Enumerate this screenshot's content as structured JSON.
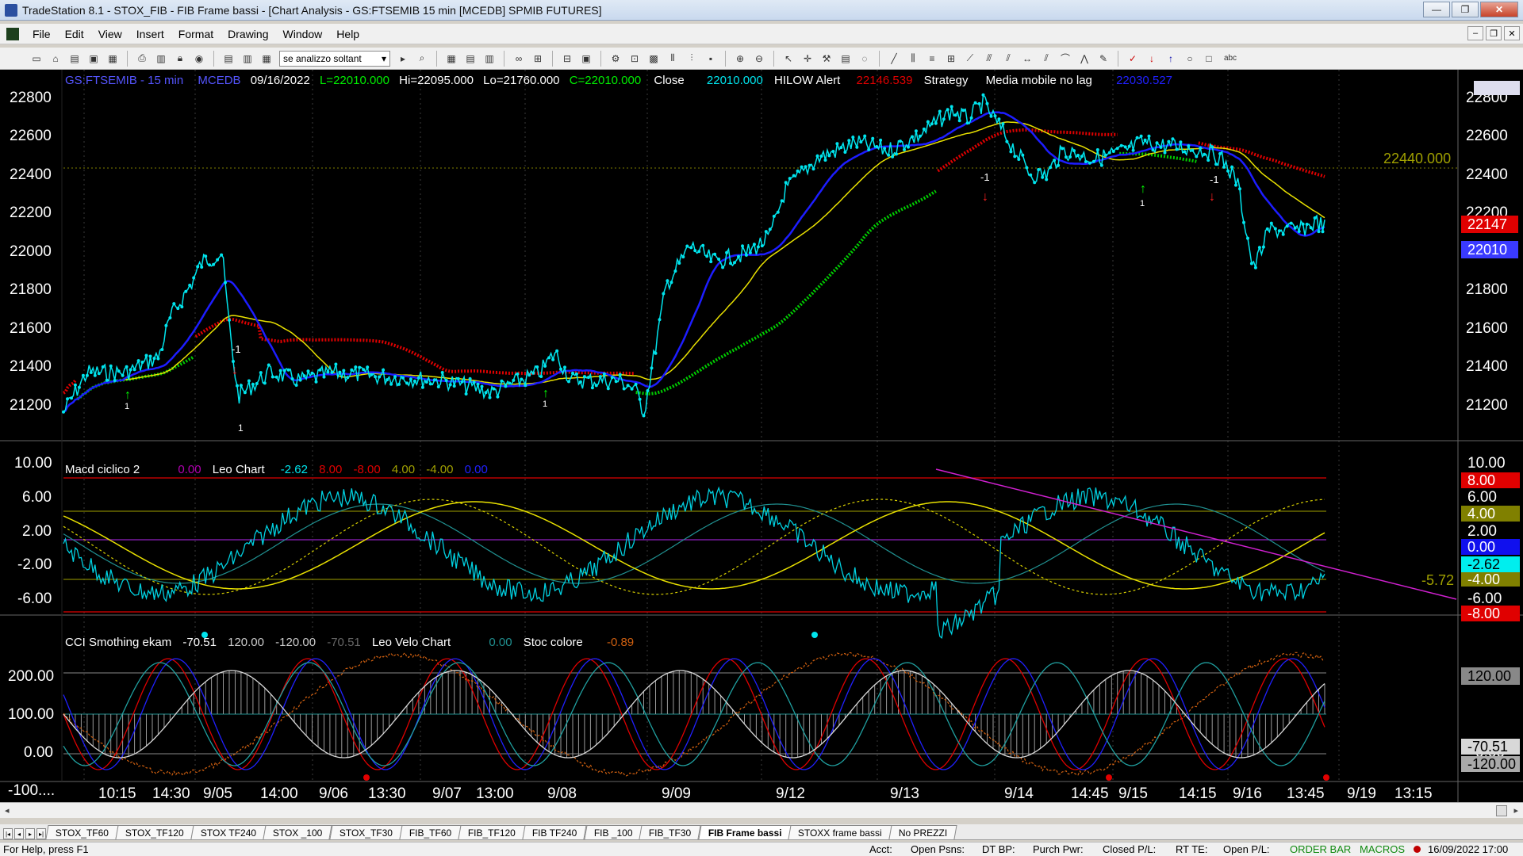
{
  "window": {
    "title": "TradeStation 8.1 - STOX_FIB - FIB Frame bassi - [Chart Analysis - GS:FTSEMIB  15 min  [MCEDB] SPMIB FUTURES]",
    "controls": [
      "—",
      "❐",
      "✕"
    ]
  },
  "menu": {
    "items": [
      "File",
      "Edit",
      "View",
      "Insert",
      "Format",
      "Drawing",
      "Window",
      "Help"
    ],
    "mdi_controls": [
      "–",
      "❐",
      "✕"
    ]
  },
  "toolbar": {
    "dropdown_value": "se analizzo soltant",
    "text_label": "abc"
  },
  "chart": {
    "price_header": {
      "symbol": "GS:FTSEMIB - 15 min",
      "source": "MCEDB",
      "date": "09/16/2022",
      "low_label": "L=22010.000",
      "hi_label": "Hi=22095.000",
      "lo_label": "Lo=21760.000",
      "close_label": "C=22010.000",
      "close_word": "Close",
      "close_value": "22010.000",
      "hilow": "HILOW Alert",
      "hilow_value": "22146.539",
      "strategy": "Strategy",
      "media": "Media mobile no lag",
      "media_value": "22030.527"
    },
    "price_axis": [
      "22800",
      "22600",
      "22400",
      "22200",
      "22000",
      "21800",
      "21600",
      "21400",
      "21200"
    ],
    "price_level_line": "22440.000",
    "price_badges": {
      "red": "22147",
      "blue": "22010"
    },
    "signals": {
      "up": "1",
      "down": "-1"
    },
    "macd_header": {
      "name": "Macd ciclico 2",
      "v1": "0.00",
      "name2": "Leo Chart",
      "v2": "-2.62",
      "v3": "8.00",
      "v4": "-8.00",
      "v5": "4.00",
      "v6": "-4.00",
      "v7": "0.00"
    },
    "macd_axis": [
      "10.00",
      "6.00",
      "2.00",
      "-2.00",
      "-6.00"
    ],
    "macd_badges": {
      "red_top": "8.00",
      "olive_top": "4.00",
      "blue": "0.00",
      "cyan": "-2.62",
      "olive_bot": "-4.00",
      "red_bot": "-8.00",
      "trend_label": "-5.72"
    },
    "cci_header": {
      "name": "CCI Smothing ekam",
      "v1": "-70.51",
      "v2": "120.00",
      "v3": "-120.00",
      "v4": "-70.51",
      "name2": "Leo Velo Chart",
      "v5": "0.00",
      "name3": "Stoc colore",
      "v6": "-0.89"
    },
    "cci_axis": [
      "200.00",
      "100.00",
      "0.00",
      "-100...."
    ],
    "cci_badges": {
      "upper": "120.00",
      "gray": "-70.51",
      "lower": "-120.00"
    },
    "time_axis": [
      "10:15",
      "14:30",
      "9/05",
      "14:00",
      "9/06",
      "13:30",
      "9/07",
      "13:00",
      "9/08",
      "9/09",
      "9/12",
      "9/13",
      "9/14",
      "14:45",
      "9/15",
      "14:15",
      "9/16",
      "13:45",
      "9/19",
      "13:15"
    ],
    "colors": {
      "background": "#000000",
      "price_cyan": "#00e5ee",
      "avg_blue": "#1d1dff",
      "avg_yellow": "#e8e000",
      "hilow_red": "#e00000",
      "hilow_green": "#00cc00",
      "trendline": "#d020d0"
    }
  },
  "tabs": [
    "STOX_TF60",
    "STOX_TF120",
    "STOX TF240",
    "STOX _100",
    "STOX_TF30",
    "FIB_TF60",
    "FIB_TF120",
    "FIB TF240",
    "FIB _100",
    "FIB_TF30",
    "FIB Frame bassi",
    "STOXX frame bassi",
    "No PREZZI"
  ],
  "active_tab": "FIB Frame bassi",
  "status": {
    "help": "For Help, press F1",
    "acct": "Acct:",
    "open_psns": "Open Psns:",
    "dt_bp": "DT BP:",
    "purch_pwr": "Purch Pwr:",
    "closed_pl": "Closed P/L:",
    "rt_te": "RT TE:",
    "open_pl": "Open P/L:",
    "order_bar": "ORDER BAR",
    "macros": "MACROS",
    "datetime": "16/09/2022 17:00"
  }
}
